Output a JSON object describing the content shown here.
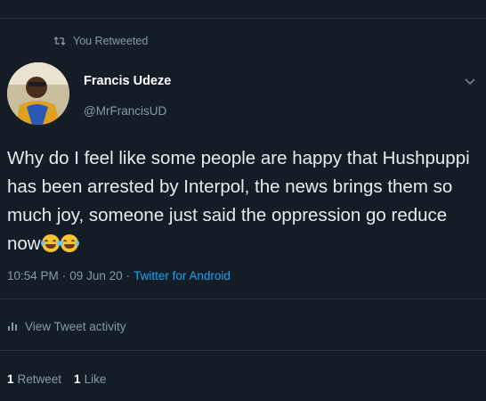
{
  "retweet": {
    "label": "You Retweeted"
  },
  "author": {
    "name": "Francis Udeze",
    "handle": "@MrFrancisUD"
  },
  "tweet": {
    "text": "Why do I feel like some people are happy that Hushpuppi has been arrested by Interpol, the news brings them so much joy, someone just said the oppression go reduce now",
    "emoji": [
      "face-with-tears-of-joy",
      "face-with-tears-of-joy"
    ]
  },
  "meta": {
    "time": "10:54 PM",
    "separator": "·",
    "date": "09 Jun 20",
    "source": "Twitter for Android"
  },
  "activity": {
    "label": "View Tweet activity"
  },
  "stats": {
    "retweets_count": "1",
    "retweets_label": "Retweet",
    "likes_count": "1",
    "likes_label": "Like"
  },
  "colors": {
    "background": "#141d26",
    "text": "#e6ecf0",
    "muted": "#8899a6",
    "link": "#1da1f2",
    "divider": "#26323d"
  },
  "icons": {
    "retweet": "retweet-icon",
    "chevron": "chevron-down-icon",
    "activity": "bar-chart-icon"
  }
}
